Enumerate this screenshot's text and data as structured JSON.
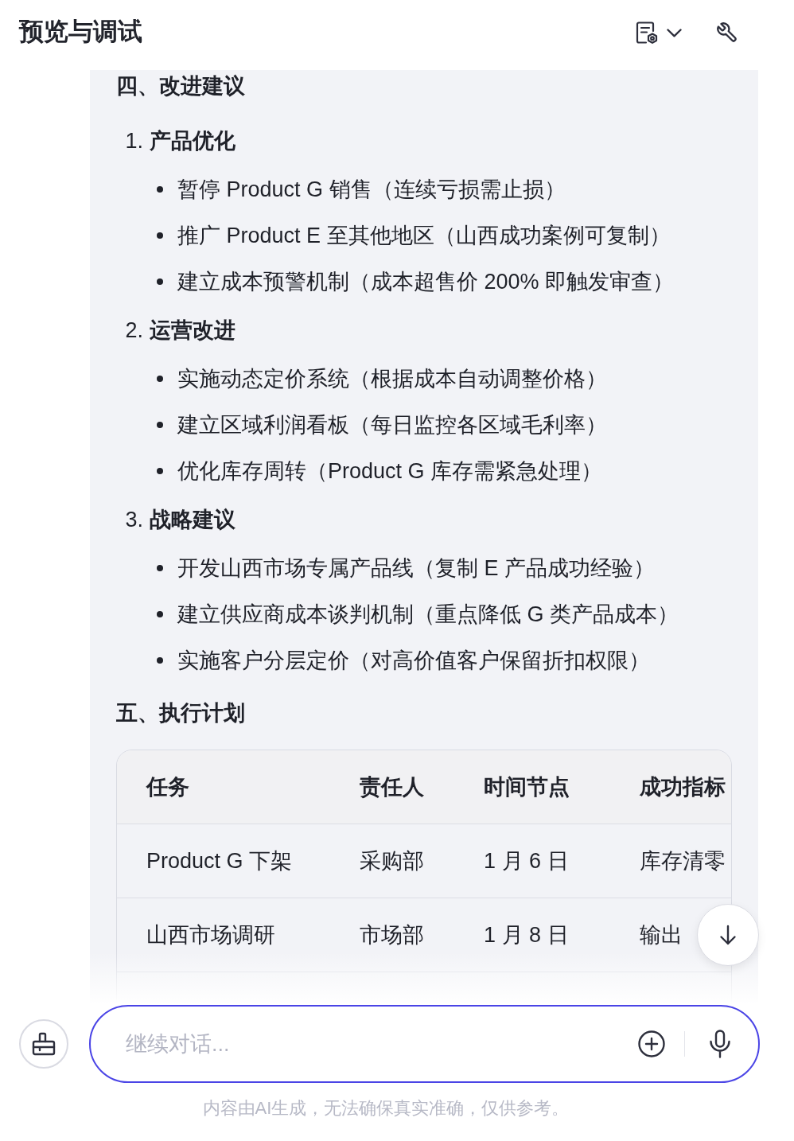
{
  "header": {
    "title": "预览与调试"
  },
  "recommendations": {
    "heading": "四、改进建议",
    "groups": [
      {
        "number": "1.",
        "title": "产品优化",
        "bullets": [
          "暂停 Product G 销售（连续亏损需止损）",
          "推广 Product E 至其他地区（山西成功案例可复制）",
          "建立成本预警机制（成本超售价 200% 即触发审查）"
        ]
      },
      {
        "number": "2.",
        "title": "运营改进",
        "bullets": [
          "实施动态定价系统（根据成本自动调整价格）",
          "建立区域利润看板（每日监控各区域毛利率）",
          "优化库存周转（Product G 库存需紧急处理）"
        ]
      },
      {
        "number": "3.",
        "title": "战略建议",
        "bullets": [
          "开发山西市场专属产品线（复制 E 产品成功经验）",
          "建立供应商成本谈判机制（重点降低 G 类产品成本）",
          "实施客户分层定价（对高价值客户保留折扣权限）"
        ]
      }
    ]
  },
  "plan": {
    "heading": "五、执行计划",
    "table": {
      "columns": [
        "任务",
        "责任人",
        "时间节点",
        "成功指标"
      ],
      "rows": [
        [
          "Product G 下架",
          "采购部",
          "1 月 6 日",
          "库存清零"
        ],
        [
          "山西市场调研",
          "市场部",
          "1 月 8 日",
          "输出"
        ]
      ]
    }
  },
  "composer": {
    "placeholder": "继续对话..."
  },
  "disclaimer": "内容由AI生成，无法确保真实准确，仅供参考。"
}
